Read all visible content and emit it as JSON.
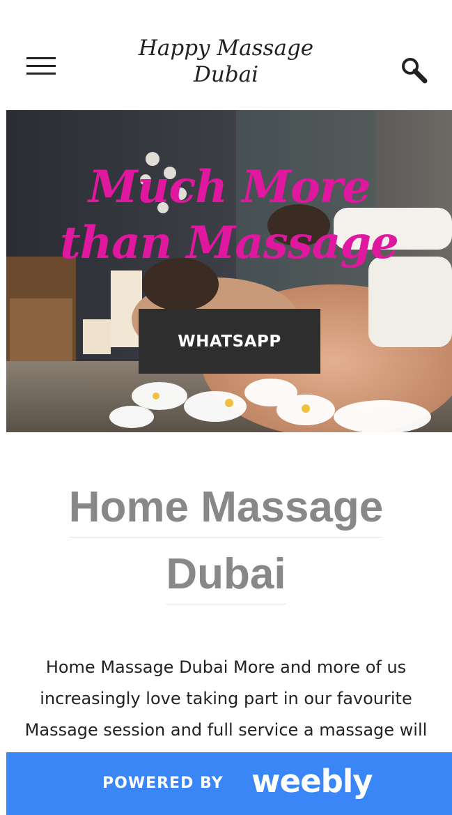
{
  "header": {
    "title_line1": "Happy Massage",
    "title_line2": "Dubai",
    "menu_icon": "hamburger-menu-icon",
    "search_icon": "search-icon"
  },
  "hero": {
    "headline_line1": "Much More",
    "headline_line2": "than Massage",
    "headline_color": "#e0179f",
    "button_label": "WHATSAPP"
  },
  "main": {
    "heading_line1": "Home Massage",
    "heading_line2": "Dubai",
    "body": "Home Massage Dubai More and more of us increasingly love taking part in our favourite Massage session and full service a massage will be nothing less than a soft touch"
  },
  "footer": {
    "powered_by": "POWERED BY",
    "brand": "weebly",
    "color": "#3a86f7"
  }
}
